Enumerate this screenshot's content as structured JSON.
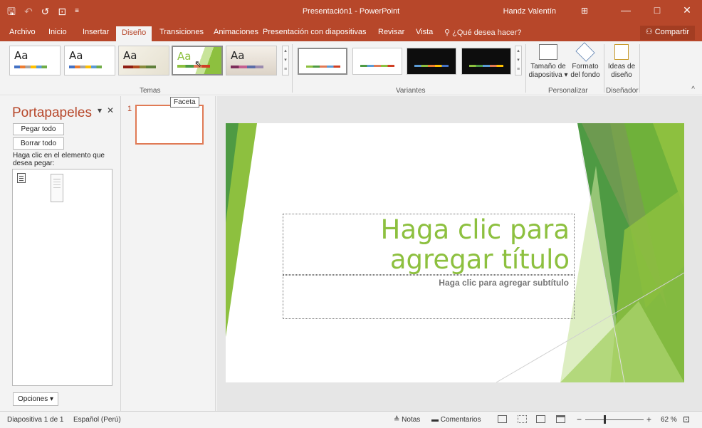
{
  "titlebar": {
    "quick_access": [
      "save-icon",
      "undo-icon",
      "redo-icon",
      "present-icon",
      "customize-icon"
    ],
    "save_glyph": "🖫",
    "undo_glyph": "↶",
    "redo_glyph": "↺",
    "present_glyph": "⊡",
    "customize_glyph": "≡",
    "document_title": "Presentación1 - PowerPoint",
    "user_name": "Handz Valentín",
    "ribbon_display_glyph": "⊞",
    "minimize_glyph": "—",
    "maximize_glyph": "□",
    "close_glyph": "✕",
    "accent_color": "#b7472a"
  },
  "tabs": {
    "archivo": "Archivo",
    "inicio": "Inicio",
    "insertar": "Insertar",
    "diseno": "Diseño",
    "transiciones": "Transiciones",
    "animaciones": "Animaciones",
    "presentacion": "Presentación con diapositivas",
    "revisar": "Revisar",
    "vista": "Vista",
    "search": "¿Qué desea hacer?",
    "search_icon": "lightbulb-icon",
    "share": "Compartir",
    "share_icon": "person-icon",
    "active": "Diseño"
  },
  "ribbon": {
    "themes": {
      "label": "Temas",
      "thumb_text": "Aa",
      "thumbs": [
        "Office",
        "Office 2",
        "Theme 3",
        "Faceta",
        "Theme 5"
      ]
    },
    "variants": {
      "label": "Variantes"
    },
    "customize": {
      "label": "Personalizar",
      "slide_size_line1": "Tamaño de",
      "slide_size_line2": "diapositiva ▾",
      "format_bg_line1": "Formato",
      "format_bg_line2": "del fondo"
    },
    "designer": {
      "label": "Diseñador",
      "ideas_line1": "Ideas de",
      "ideas_line2": "diseño"
    },
    "collapse_glyph": "^"
  },
  "clipboard_pane": {
    "title": "Portapapeles",
    "menu_glyph": "▾",
    "close_glyph": "✕",
    "paste_all": "Pegar todo",
    "clear_all": "Borrar todo",
    "hint": "Haga clic en el elemento que desea pegar:",
    "options": "Opciones ▾"
  },
  "thumbnails": {
    "slide_number": "1",
    "tooltip": "Faceta"
  },
  "slide": {
    "title_placeholder": "Haga clic para agregar título",
    "subtitle_placeholder": "Haga clic para agregar subtítulo",
    "theme_green": "#8dc03f"
  },
  "statusbar": {
    "slide_info": "Diapositiva 1 de 1",
    "language": "Español (Perú)",
    "notes": "≜ Notas",
    "comments": "Comentarios",
    "zoom_minus": "−",
    "zoom_plus": "+",
    "zoom_value": "62 %",
    "zoom_percent": 62,
    "fit_glyph": "⊡"
  }
}
